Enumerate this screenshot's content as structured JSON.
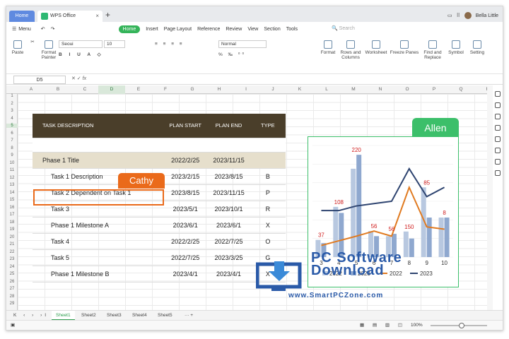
{
  "titlebar": {
    "home_tab": "Home",
    "doc_tab": "WPS Office",
    "user_name": "Bella Little"
  },
  "menubar": {
    "menu_label": "Menu",
    "items": [
      "Home",
      "Insert",
      "Page Layout",
      "Reference",
      "Review",
      "View",
      "Section",
      "Tools"
    ],
    "search_placeholder": "Search"
  },
  "ribbon": {
    "paste": "Paste",
    "format_painter": "Format Painter",
    "font_name": "Seoui",
    "font_size": "10",
    "number_format": "Normal",
    "format": "Format",
    "rows_columns": "Rows and Columns",
    "worksheet": "Worksheet",
    "freeze_panes": "Freeze Panes",
    "find_replace": "Find and Replace",
    "symbol": "Symbol",
    "setting": "Setting"
  },
  "formula_bar": {
    "name_box": "D5",
    "fx": "fx"
  },
  "columns": [
    "A",
    "B",
    "C",
    "D",
    "E",
    "F",
    "G",
    "H",
    "I",
    "J",
    "K",
    "L",
    "M",
    "N",
    "O",
    "P",
    "Q",
    "R"
  ],
  "rows": [
    "1",
    "2",
    "3",
    "4",
    "5",
    "6",
    "7",
    "8",
    "9",
    "10",
    "11",
    "12",
    "13",
    "14",
    "15",
    "16",
    "17",
    "18",
    "19",
    "20",
    "21",
    "22",
    "23",
    "24",
    "25",
    "26",
    "27",
    "28",
    "29"
  ],
  "table": {
    "headers": [
      "TASK DESCRIPTION",
      "PLAN START",
      "PLAN END",
      "TYPE"
    ],
    "rows": [
      {
        "task": "Phase 1 Title",
        "start": "2022/2/25",
        "end": "2023/11/15",
        "type": ""
      },
      {
        "task": "Task 1 Description",
        "start": "2023/2/15",
        "end": "2023/8/15",
        "type": "B"
      },
      {
        "task": "Task 2 Dependent on Task 1",
        "start": "2023/8/15",
        "end": "2023/11/15",
        "type": "P"
      },
      {
        "task": "Task 3",
        "start": "2023/5/1",
        "end": "2023/10/1",
        "type": "R"
      },
      {
        "task": "Phase 1 Milestone A",
        "start": "2023/6/1",
        "end": "2023/6/1",
        "type": "X"
      },
      {
        "task": "Task 4",
        "start": "2022/2/25",
        "end": "2022/7/25",
        "type": "O"
      },
      {
        "task": "Task 5",
        "start": "2022/7/25",
        "end": "2023/3/25",
        "type": "G"
      },
      {
        "task": "Phase 1 Milestone B",
        "start": "2023/4/1",
        "end": "2023/4/1",
        "type": "X"
      }
    ]
  },
  "labels": {
    "cathy": "Cathy",
    "allen": "Allen"
  },
  "chart_data": {
    "type": "bar",
    "categories": [
      "3",
      "4",
      "5",
      "6",
      "7",
      "8",
      "9",
      "10"
    ],
    "series": [
      {
        "name": "2022",
        "kind": "bar",
        "values": [
          37,
          108,
          190,
          56,
          45,
          55,
          150,
          85
        ]
      },
      {
        "name": "2023",
        "kind": "bar",
        "values": [
          30,
          95,
          220,
          45,
          50,
          40,
          85,
          85
        ]
      },
      {
        "name": "2022",
        "kind": "line",
        "values": [
          25,
          35,
          45,
          56,
          45,
          150,
          65,
          60
        ]
      },
      {
        "name": "2023",
        "kind": "line",
        "values": [
          100,
          100,
          110,
          115,
          120,
          190,
          130,
          150
        ]
      }
    ],
    "data_labels": [
      "37",
      "108",
      "220",
      "56",
      "56",
      "150",
      "85",
      "8"
    ],
    "legend": [
      "2022",
      "2023",
      "2022",
      "2023"
    ],
    "ylim": [
      0,
      240
    ],
    "colors": {
      "bar_light": "#b8c8e0",
      "bar_mid": "#8fa8cf",
      "line_orange": "#e07a20",
      "line_navy": "#2e4470"
    }
  },
  "sheets": [
    "Sheet1",
    "Sheet2",
    "Sheet3",
    "Sheet4",
    "Sheet5"
  ],
  "status": {
    "zoom": "100%"
  },
  "watermark": {
    "line1": "PC Software",
    "line2": "Download",
    "line3": "www.SmartPCZone.com"
  }
}
